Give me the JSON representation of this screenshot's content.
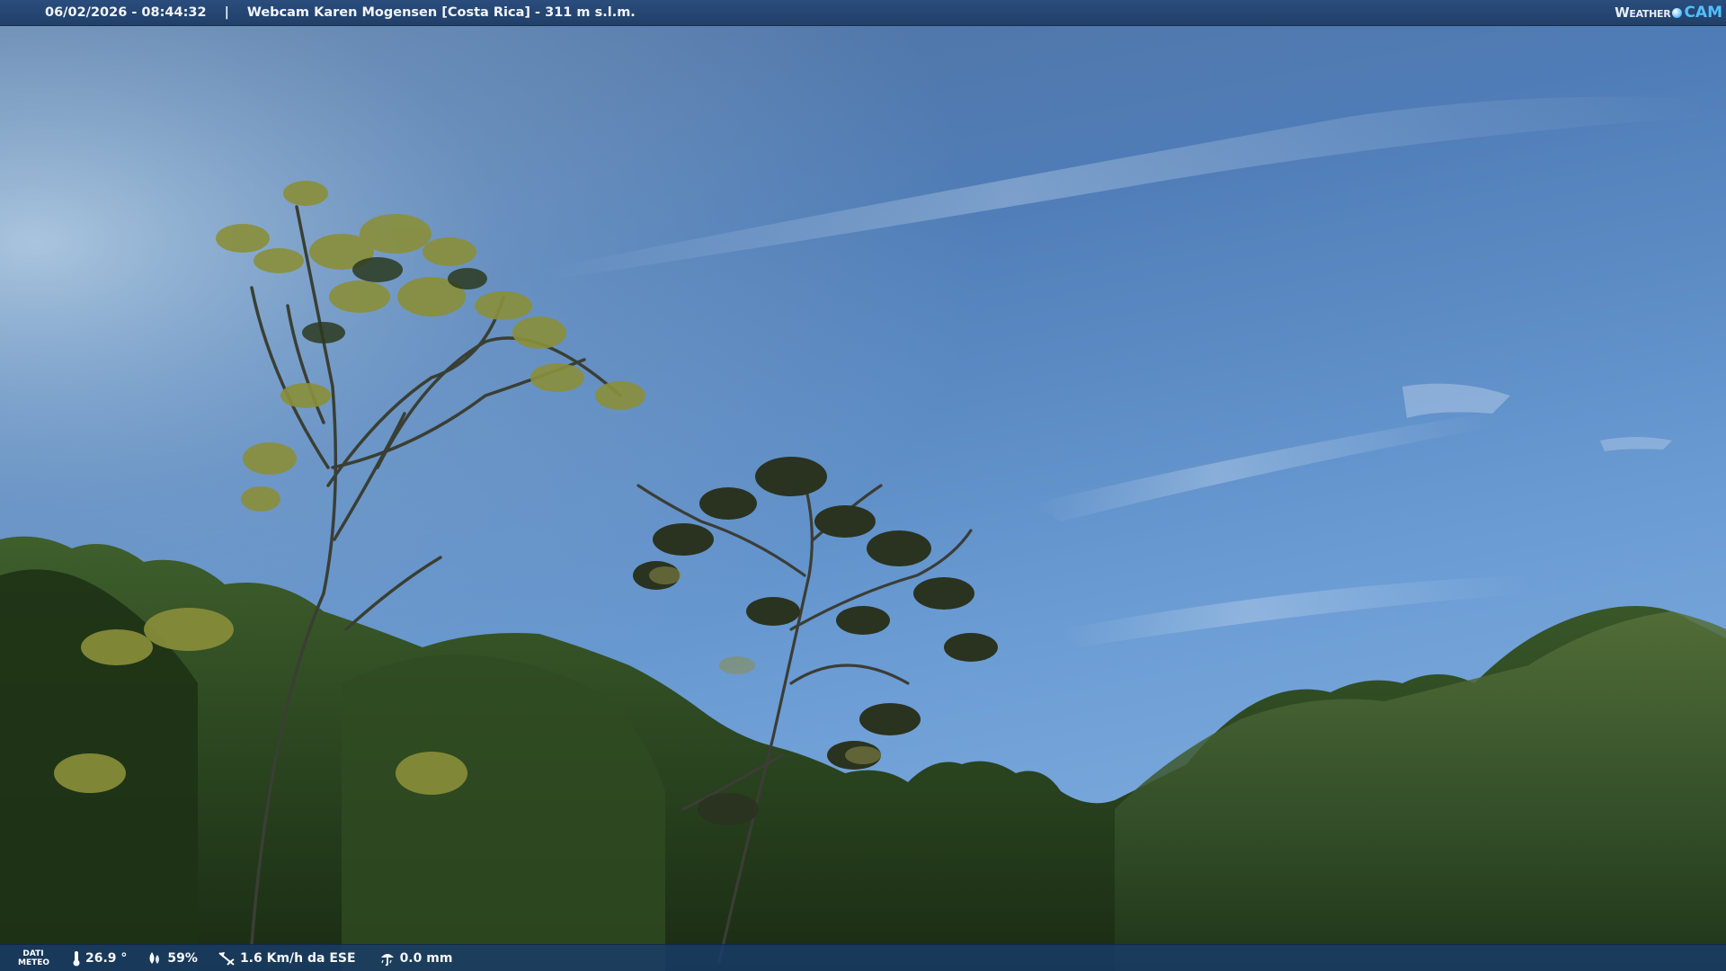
{
  "header": {
    "date_time": "06/02/2026 - 08:44:32",
    "separator": "|",
    "station": "Webcam Karen Mogensen [Costa Rica] - 311 m s.l.m.",
    "brand_left": "Weather",
    "brand_right": "CAM"
  },
  "footer": {
    "meteo_label_line1": "DATI",
    "meteo_label_line2": "METEO",
    "temperature": "26.9 °",
    "humidity": "59%",
    "wind": "1.6 Km/h da ESE",
    "rain": "0.0 mm"
  },
  "icons": {
    "temperature": "thermometer-icon",
    "humidity": "humidity-drops-icon",
    "wind": "wind-vane-icon",
    "rain": "rain-gauge-icon"
  },
  "colors": {
    "bar_top": "#2a4d7d",
    "bar_bottom": "#183c6e",
    "brand_accent": "#4fc0ff",
    "sky_top": "#5d7fae",
    "sky_bottom": "#6f9ed3",
    "foliage_dark": "#1f3318"
  }
}
